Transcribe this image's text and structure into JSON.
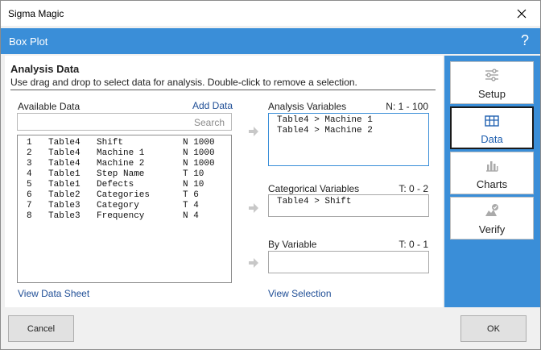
{
  "window": {
    "title": "Sigma Magic"
  },
  "header": {
    "title": "Box Plot",
    "help": "?"
  },
  "section": {
    "title": "Analysis Data",
    "subtitle": "Use drag and drop to select data for analysis. Double-click to remove a selection."
  },
  "available": {
    "label": "Available Data",
    "add_link": "Add Data",
    "search_placeholder": "Search",
    "rows": [
      {
        "idx": "1",
        "table": "Table4",
        "name": "Shift",
        "type": "N 1000"
      },
      {
        "idx": "2",
        "table": "Table4",
        "name": "Machine 1",
        "type": "N 1000"
      },
      {
        "idx": "3",
        "table": "Table4",
        "name": "Machine 2",
        "type": "N 1000"
      },
      {
        "idx": "4",
        "table": "Table1",
        "name": "Step Name",
        "type": "T 10"
      },
      {
        "idx": "5",
        "table": "Table1",
        "name": "Defects",
        "type": "N 10"
      },
      {
        "idx": "6",
        "table": "Table2",
        "name": "Categories",
        "type": "T 6"
      },
      {
        "idx": "7",
        "table": "Table3",
        "name": "Category",
        "type": "T 4"
      },
      {
        "idx": "8",
        "table": "Table3",
        "name": "Frequency",
        "type": "N 4"
      }
    ],
    "view_link": "View Data Sheet"
  },
  "analysis_vars": {
    "label": "Analysis Variables",
    "range": "N: 1 - 100",
    "items": [
      "Table4 > Machine 1",
      "Table4 > Machine 2"
    ]
  },
  "categorical_vars": {
    "label": "Categorical Variables",
    "range": "T: 0 - 2",
    "items": [
      "Table4 > Shift"
    ]
  },
  "by_var": {
    "label": "By Variable",
    "range": "T: 0 - 1",
    "items": []
  },
  "view_selection": "View Selection",
  "sidebar": {
    "items": [
      {
        "label": "Setup",
        "icon": "sliders-icon"
      },
      {
        "label": "Data",
        "icon": "table-icon"
      },
      {
        "label": "Charts",
        "icon": "bar-chart-icon"
      },
      {
        "label": "Verify",
        "icon": "verify-icon"
      }
    ]
  },
  "footer": {
    "cancel": "Cancel",
    "ok": "OK"
  },
  "colors": {
    "accent": "#3a8ed8",
    "link": "#1f4e96"
  }
}
